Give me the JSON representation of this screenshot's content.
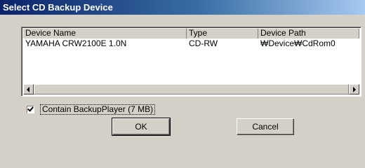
{
  "window": {
    "title": "Select CD Backup Device"
  },
  "list": {
    "columns": [
      "Device Name",
      "Type",
      "Device Path"
    ],
    "rows": [
      {
        "device_name": "YAMAHA CRW2100E 1.0N",
        "type": "CD-RW",
        "device_path": "₩Device₩CdRom0"
      }
    ]
  },
  "options": {
    "contain_backupplayer_label": "Contain BackupPlayer (7 MB)",
    "contain_backupplayer_checked": true
  },
  "buttons": {
    "ok_label": "OK",
    "cancel_label": "Cancel"
  },
  "icons": {
    "scroll_left": "scroll-left-arrow-icon",
    "scroll_right": "scroll-right-arrow-icon",
    "checkmark": "checkmark-icon"
  }
}
